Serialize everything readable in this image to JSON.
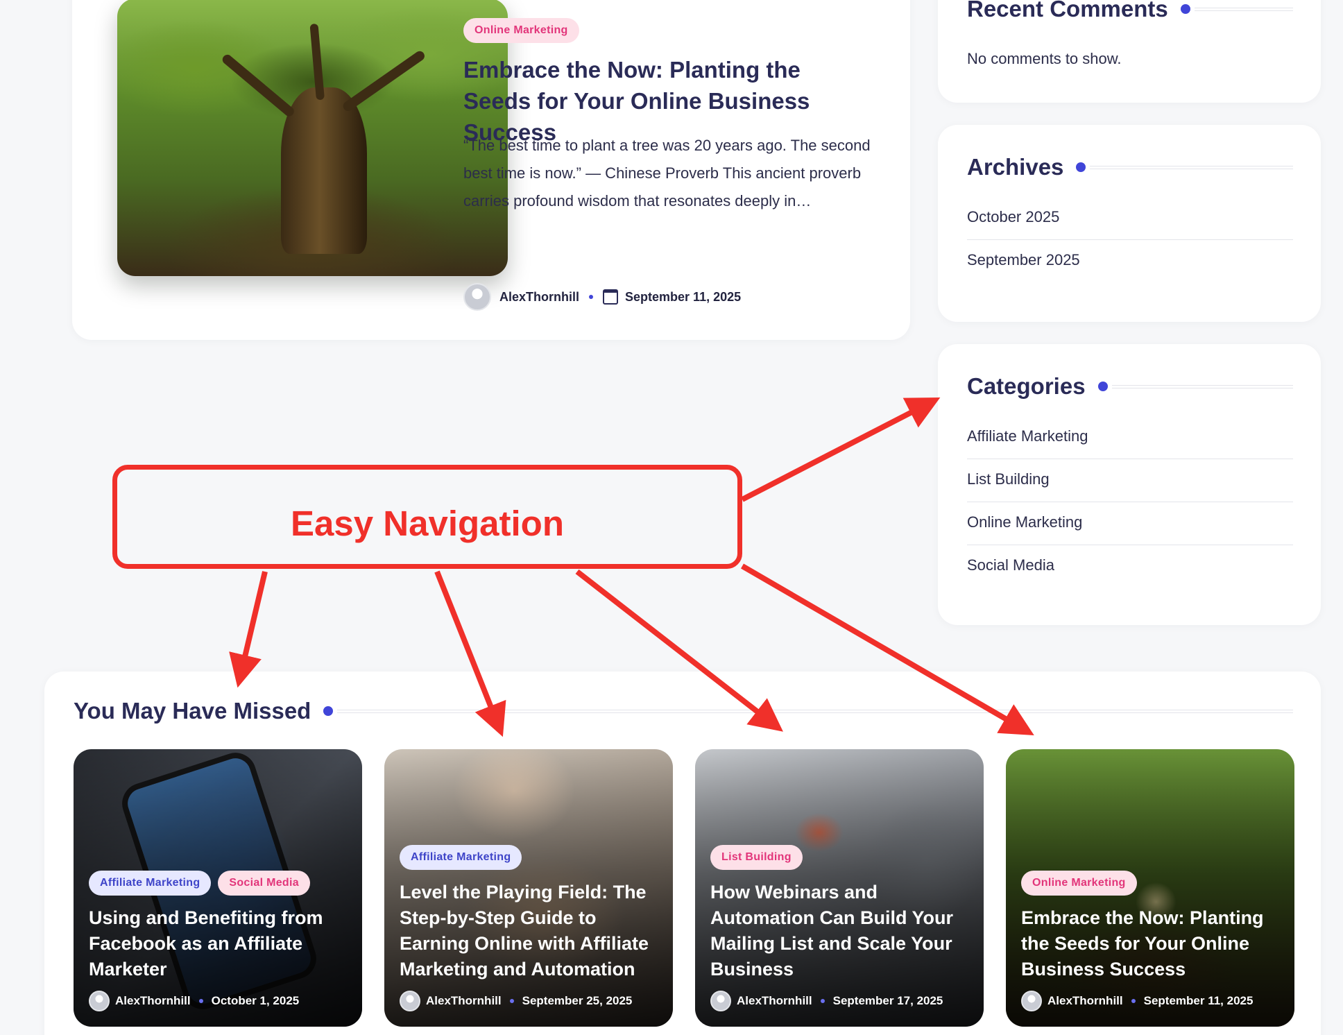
{
  "featured": {
    "tag": "Online Marketing",
    "title": "Embrace the Now: Planting the Seeds for Your Online Business Success",
    "excerpt": "“The best time to plant a tree was 20 years ago. The second best time is now.” — Chinese Proverb This ancient proverb carries profound wisdom that resonates deeply in…",
    "author": "AlexThornhill",
    "date": "September 11, 2025"
  },
  "sidebar": {
    "recent_comments": {
      "title": "Recent Comments",
      "empty": "No comments to show."
    },
    "archives": {
      "title": "Archives",
      "items": [
        "October 2025",
        "September 2025"
      ]
    },
    "categories": {
      "title": "Categories",
      "items": [
        "Affiliate Marketing",
        "List Building",
        "Online Marketing",
        "Social Media"
      ]
    }
  },
  "annotation": {
    "label": "Easy Navigation",
    "color": "#f0302a"
  },
  "missed": {
    "title": "You May Have Missed",
    "posts": [
      {
        "tags": [
          "Affiliate Marketing",
          "Social Media"
        ],
        "title": "Using and Benefiting from Facebook as an Affiliate Marketer",
        "author": "AlexThornhill",
        "date": "October 1, 2025"
      },
      {
        "tags": [
          "Affiliate Marketing"
        ],
        "title": "Level the Playing Field: The Step-by-Step Guide to Earning Online with Affiliate Marketing and Automation",
        "author": "AlexThornhill",
        "date": "September 25, 2025"
      },
      {
        "tags": [
          "List Building"
        ],
        "title": "How Webinars and Automation Can Build Your Mailing List and Scale Your Business",
        "author": "AlexThornhill",
        "date": "September 17, 2025"
      },
      {
        "tags": [
          "Online Marketing"
        ],
        "title": "Embrace the Now: Planting the Seeds for Your Online Business Success",
        "author": "AlexThornhill",
        "date": "September 11, 2025"
      }
    ]
  },
  "colors": {
    "accent": "#4045d8",
    "heading": "#2a2b57",
    "tag_pink_bg": "#fde0e8",
    "tag_pink_text": "#e2357a",
    "tag_blue_bg": "#e6e8ff",
    "tag_blue_text": "#3e44c8"
  }
}
